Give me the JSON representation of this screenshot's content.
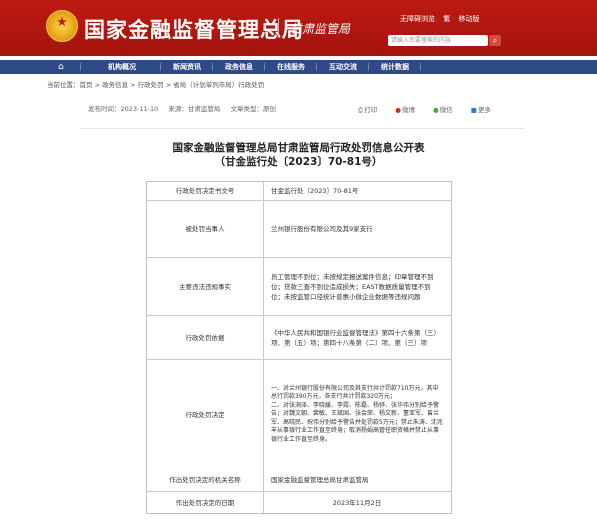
{
  "header": {
    "site_title": "国家金融监督管理总局",
    "sub_title": "甘肃监管局",
    "top_links": [
      "无障碍浏览",
      "繁",
      "移动版"
    ],
    "search_placeholder": "请输入您要搜索的内容",
    "brand_color": "#b5170f"
  },
  "nav": {
    "items": [
      "机构概况",
      "新闻资讯",
      "政务信息",
      "在线服务",
      "互动交流",
      "统计数据"
    ],
    "color": "#2f4a86"
  },
  "breadcrumb": "当前位置：首页 > 政务信息 > 行政处罚 > 省局（计划单列市局）行政处罚",
  "meta": {
    "publish_date": "发布时间：2023-11-10",
    "source": "来源：甘肃监管局",
    "type": "文章类型：原创"
  },
  "share": {
    "print": "打印",
    "weibo": "微博",
    "wechat": "微信",
    "more": "更多"
  },
  "document": {
    "title": "国家金融监督管理总局甘肃监管局行政处罚信息公开表",
    "subtitle": "（甘金监行处〔2023〕70-81号）"
  },
  "table": {
    "rows": [
      {
        "label": "行政处罚决定书文号",
        "value": [
          "甘金监行处〔2023〕70-81号"
        ]
      },
      {
        "label": "被处罚当事人",
        "value": [
          "兰州银行股份有限公司及其9家支行"
        ]
      },
      {
        "label": "主要违法违规事实",
        "value": [
          "员工管理不到位；未按规定报送案件信息；印章管理不到位；贷款三查不到位造成损失；EAST数据质量管理不到位；未按监管口径统计普惠小微企业数据等违规问题"
        ]
      },
      {
        "label": "行政处罚依据",
        "value": [
          "《中华人民共和国银行业监督管理法》第四十六条第（三）项、第（五）项；第四十八条第（二）项、第（三）项"
        ]
      },
      {
        "label": "行政处罚决定",
        "value": [
          "一、对兰州银行股份有限公司及其支行共计罚款710万元，其中总行罚款390万元，各支行共计罚款320万元；",
          "二、对张洞泽、李晓媛、李霞、陈磊、杨骅、张华伟分别给予警告；对魏文朝、裴敏、王斌国、张会荣、杨文新、董亚军、曾兰军、高晓民、祝伟分别给予警告并处罚款5万元；禁止朱涛、沈兆丰从事银行业工作直至终身；取消杨娟高管任职资格并禁止从事银行业工作直至终身。"
        ]
      },
      {
        "label": "作出处罚决定的机关名称",
        "value": [
          "国家金融监督管理总局甘肃监管局"
        ]
      },
      {
        "label": "作出处罚决定的日期",
        "value": [
          "2023年11月2日"
        ]
      }
    ]
  }
}
